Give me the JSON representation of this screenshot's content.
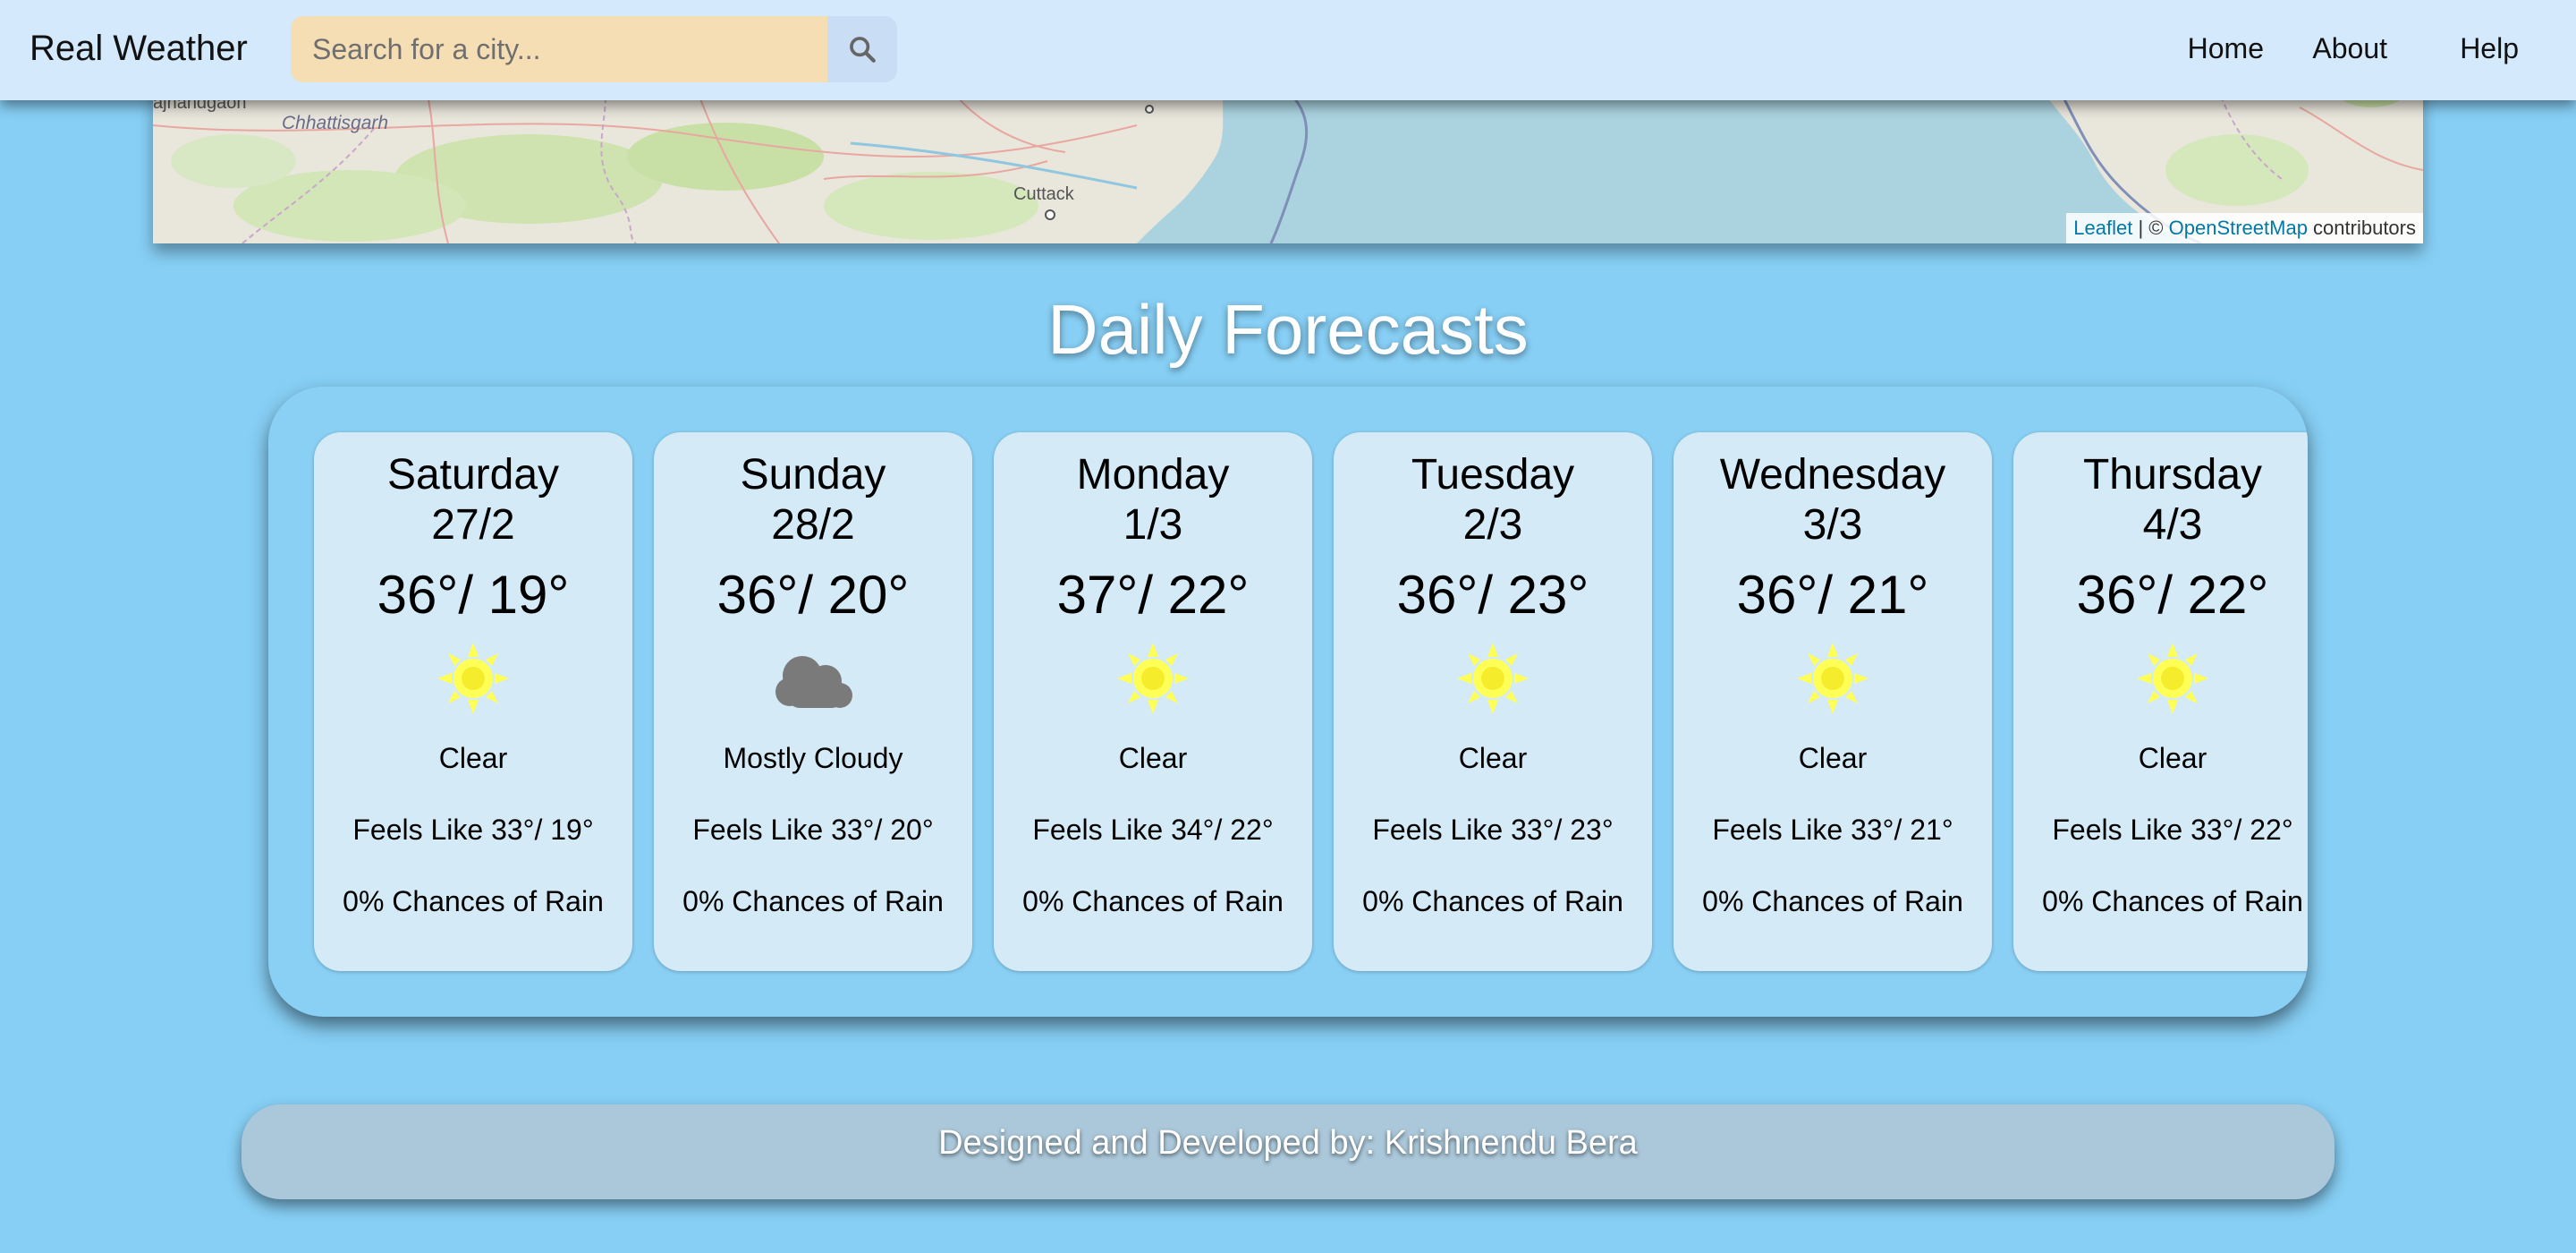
{
  "navbar": {
    "brand": "Real Weather",
    "search": {
      "placeholder": "Search for a city...",
      "value": "",
      "button_icon": "search-icon"
    },
    "links": [
      "Home",
      "About",
      "Help"
    ]
  },
  "map": {
    "labels": {
      "rajnandgaon": "ajnandgaon",
      "chhattisgarh": "Chhattisgarh",
      "cuttack": "Cuttack"
    },
    "attribution": {
      "leaflet": "Leaflet",
      "separator": " | © ",
      "osm": "OpenStreetMap",
      "suffix": " contributors"
    }
  },
  "forecast": {
    "title": "Daily Forecasts",
    "days": [
      {
        "day": "Saturday",
        "date": "27/2",
        "temp": "36°/ 19°",
        "icon": "sun-icon",
        "condition": "Clear",
        "feels_like": "Feels Like 33°/ 19°",
        "rain": "0% Chances of Rain"
      },
      {
        "day": "Sunday",
        "date": "28/2",
        "temp": "36°/ 20°",
        "icon": "cloud-icon",
        "condition": "Mostly Cloudy",
        "feels_like": "Feels Like 33°/ 20°",
        "rain": "0% Chances of Rain"
      },
      {
        "day": "Monday",
        "date": "1/3",
        "temp": "37°/ 22°",
        "icon": "sun-icon",
        "condition": "Clear",
        "feels_like": "Feels Like 34°/ 22°",
        "rain": "0% Chances of Rain"
      },
      {
        "day": "Tuesday",
        "date": "2/3",
        "temp": "36°/ 23°",
        "icon": "sun-icon",
        "condition": "Clear",
        "feels_like": "Feels Like 33°/ 23°",
        "rain": "0% Chances of Rain"
      },
      {
        "day": "Wednesday",
        "date": "3/3",
        "temp": "36°/ 21°",
        "icon": "sun-icon",
        "condition": "Clear",
        "feels_like": "Feels Like 33°/ 21°",
        "rain": "0% Chances of Rain"
      },
      {
        "day": "Thursday",
        "date": "4/3",
        "temp": "36°/ 22°",
        "icon": "sun-icon",
        "condition": "Clear",
        "feels_like": "Feels Like 33°/ 22°",
        "rain": "0% Chances of Rain"
      }
    ]
  },
  "footer": {
    "text": "Designed and Developed by: Krishnendu Bera"
  },
  "colors": {
    "page_bg": "#87cff5",
    "navbar_bg": "#d4e9fb",
    "search_bg": "#f5deb3",
    "card_bg": "#d4eaf7",
    "sun": "#ffff55",
    "cloud": "#7a7a7a",
    "footer_bg": "#abc8da"
  }
}
